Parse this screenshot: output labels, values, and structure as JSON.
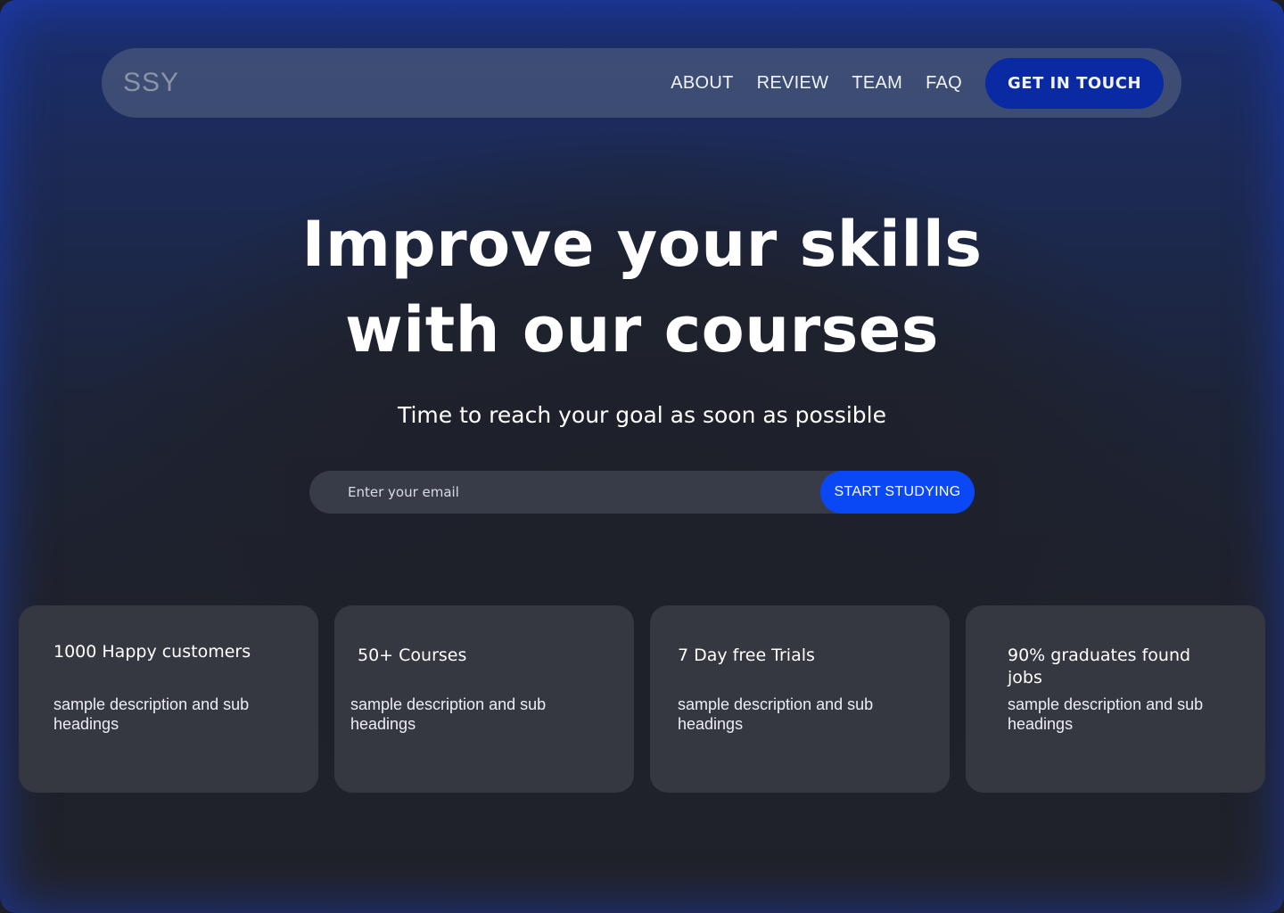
{
  "nav": {
    "logo": "SSY",
    "links": [
      "ABOUT",
      "REVIEW",
      "TEAM",
      "FAQ"
    ],
    "cta_label": "GET IN TOUCH"
  },
  "hero": {
    "title_line1": "Improve your skills",
    "title_line2": "with our courses",
    "subtitle": "Time to reach your goal as soon as possible"
  },
  "signup": {
    "email_placeholder": "Enter your email",
    "button_label": "START STUDYING"
  },
  "stats": [
    {
      "title": "1000  Happy customers",
      "description": "sample description and sub headings"
    },
    {
      "title": "50+ Courses",
      "description": "sample description and sub headings"
    },
    {
      "title": "7 Day free Trials",
      "description": "sample description and sub headings"
    },
    {
      "title": "90% graduates found jobs",
      "description": "sample description and sub headings"
    }
  ],
  "colors": {
    "accent": "#0b48f5",
    "cta_background": "#0a2aa3",
    "card_background": "#353840"
  }
}
